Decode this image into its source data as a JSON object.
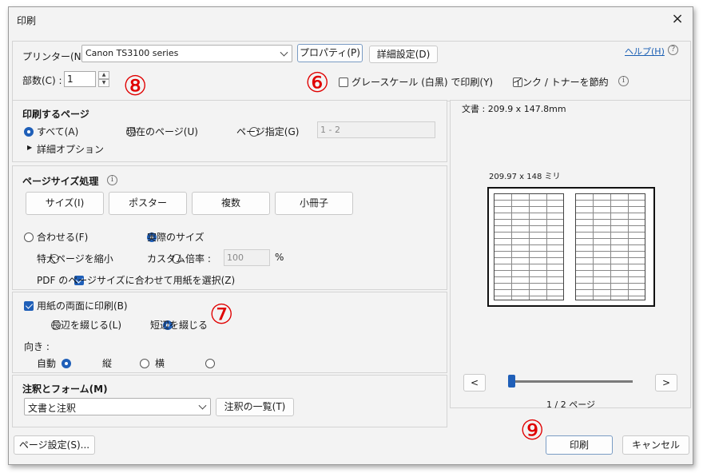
{
  "window": {
    "title": "印刷",
    "close_symbol": "×"
  },
  "printer": {
    "label": "プリンター(N) :",
    "selected": "Canon TS3100 series",
    "properties_button": "プロパティ(P)",
    "advanced_button": "詳細設定(D)",
    "help_link": "ヘルプ(H)",
    "help_symbol": "?"
  },
  "copies": {
    "label": "部数(C) :",
    "value": "1",
    "up": "▲",
    "down": "▼"
  },
  "options": {
    "grayscale": "グレースケール (白黒) で印刷(Y)",
    "save_ink": "インク / トナーを節約",
    "info_symbol": "i"
  },
  "pages": {
    "heading": "印刷するページ",
    "all": "すべて(A)",
    "current": "現在のページ(U)",
    "range": "ページ指定(G)",
    "range_value": "1 - 2",
    "more_options": "詳細オプション",
    "expand_symbol": "▶"
  },
  "sizing": {
    "heading": "ページサイズ処理",
    "info_symbol": "i",
    "buttons": [
      "サイズ(I)",
      "ポスター",
      "複数",
      "小冊子"
    ],
    "fit": "合わせる(F)",
    "actual": "実際のサイズ",
    "shrink": "特大ページを縮小",
    "custom": "カスタム倍率 :",
    "custom_value": "100",
    "percent": "%",
    "pdf_size": "PDF のページサイズに合わせて用紙を選択(Z)"
  },
  "duplex": {
    "label": "用紙の両面に印刷(B)",
    "long_edge": "長辺を綴じる(L)",
    "short_edge": "短辺を綴じる"
  },
  "orientation": {
    "label": "向き :",
    "auto": "自動",
    "portrait": "縦",
    "landscape": "横"
  },
  "comments": {
    "heading": "注釈とフォーム(M)",
    "selected": "文書と注釈",
    "summary_button": "注釈の一覧(T)"
  },
  "preview": {
    "doc_size": "文書 : 209.9 x 147.8mm",
    "sheet_size": "209.97 x 148 ミリ",
    "prev": "<",
    "next": ">",
    "page_label": "1 / 2 ページ",
    "page_position": 0.0
  },
  "footer": {
    "page_setup": "ページ設定(S)...",
    "print": "印刷",
    "cancel": "キャンセル"
  },
  "annotations": {
    "n6": "⑥",
    "n7": "⑦",
    "n8": "⑧",
    "n9": "⑨"
  },
  "colors": {
    "accent": "#1f5fb8",
    "annotation": "#e00000"
  }
}
